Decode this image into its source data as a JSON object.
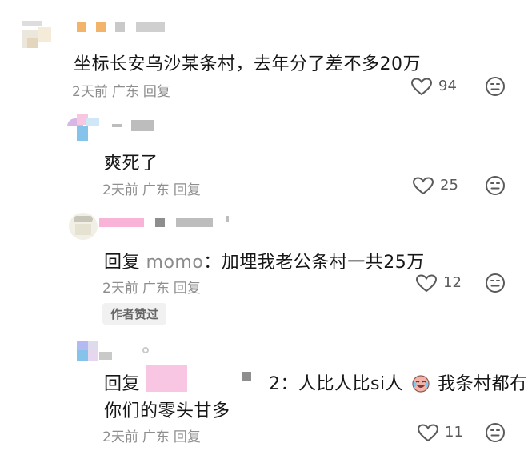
{
  "comments": [
    {
      "text": "坐标长安乌沙某条村，去年分了差不多20万",
      "time": "2天前",
      "location": "广东",
      "reply_label": "回复",
      "likes": "94"
    },
    {
      "text": "爽死了",
      "time": "2天前",
      "location": "广东",
      "reply_label": "回复",
      "likes": "25"
    },
    {
      "prefix": "回复",
      "reply_to": "momo",
      "text": "：加埋我老公条村一共25万",
      "time": "2天前",
      "location": "广东",
      "reply_label": "回复",
      "likes": "12",
      "badge": "作者赞过"
    },
    {
      "prefix": "回复",
      "text_a": "2：人比人比si人",
      "text_b": "我条村都冇",
      "text_line2": "你们的零头甘多",
      "time": "2天前",
      "location": "广东",
      "reply_label": "回复",
      "likes": "11"
    }
  ],
  "icons": {
    "like": "heart-outline-icon",
    "dislike": "neutral-face-icon",
    "emoji": "crying-laughing-emoji"
  },
  "colors": {
    "meta_text": "#8e8e8e",
    "blur_orange": "#f2b36b",
    "blur_blue": "#86c3ea",
    "blur_pink": "#f8b3d6",
    "blur_gray": "#c9c9c9"
  }
}
